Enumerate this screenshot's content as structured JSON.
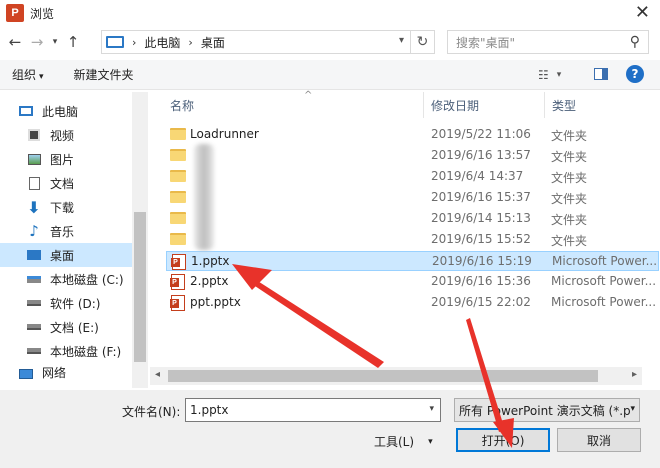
{
  "window": {
    "title": "浏览",
    "app_icon_letter": "P"
  },
  "nav": {
    "breadcrumb": [
      "此电脑",
      "桌面"
    ],
    "search_placeholder": "搜索\"桌面\""
  },
  "toolbar": {
    "organize_label": "组织",
    "new_folder_label": "新建文件夹"
  },
  "sidebar": {
    "items": [
      {
        "label": "此电脑",
        "icon": "pc-icon"
      },
      {
        "label": "视频",
        "icon": "video-icon"
      },
      {
        "label": "图片",
        "icon": "picture-icon"
      },
      {
        "label": "文档",
        "icon": "document-icon"
      },
      {
        "label": "下载",
        "icon": "download-icon"
      },
      {
        "label": "音乐",
        "icon": "music-icon"
      },
      {
        "label": "桌面",
        "icon": "desktop-icon",
        "selected": true
      },
      {
        "label": "本地磁盘 (C:)",
        "icon": "disk-icon"
      },
      {
        "label": "软件 (D:)",
        "icon": "disk-icon"
      },
      {
        "label": "文档 (E:)",
        "icon": "disk-icon"
      },
      {
        "label": "本地磁盘 (F:)",
        "icon": "disk-icon"
      },
      {
        "label": "网络",
        "icon": "network-icon"
      }
    ]
  },
  "columns": {
    "name": "名称",
    "date": "修改日期",
    "type": "类型"
  },
  "files": [
    {
      "name": "Loadrunner",
      "date": "2019/5/22 11:06",
      "type": "文件夹",
      "kind": "folder"
    },
    {
      "name": "",
      "date": "2019/6/16 13:57",
      "type": "文件夹",
      "kind": "folder"
    },
    {
      "name": "",
      "date": "2019/6/4 14:37",
      "type": "文件夹",
      "kind": "folder"
    },
    {
      "name": "",
      "date": "2019/6/16 15:37",
      "type": "文件夹",
      "kind": "folder"
    },
    {
      "name": "",
      "date": "2019/6/14 15:13",
      "type": "文件夹",
      "kind": "folder"
    },
    {
      "name": "",
      "date": "2019/6/15 15:52",
      "type": "文件夹",
      "kind": "folder"
    },
    {
      "name": "1.pptx",
      "date": "2019/6/16 15:19",
      "type": "Microsoft Power...",
      "kind": "ppt",
      "selected": true
    },
    {
      "name": "2.pptx",
      "date": "2019/6/16 15:36",
      "type": "Microsoft Power...",
      "kind": "ppt"
    },
    {
      "name": "ppt.pptx",
      "date": "2019/6/15 22:02",
      "type": "Microsoft Power...",
      "kind": "ppt"
    }
  ],
  "bottom": {
    "filename_label": "文件名(N):",
    "filename_value": "1.pptx",
    "filetype_value": "所有 PowerPoint 演示文稿 (*.p",
    "tools_label": "工具(L)",
    "open_label": "打开(O)",
    "cancel_label": "取消"
  },
  "colors": {
    "selection": "#cce8ff",
    "accent": "#0078d7",
    "annotation": "#e8322a"
  }
}
